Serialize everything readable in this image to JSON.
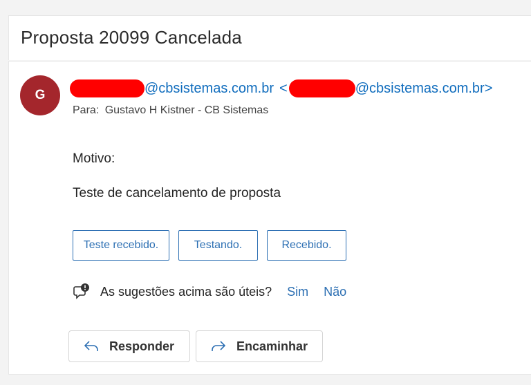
{
  "subject": "Proposta 20099 Cancelada",
  "sender": {
    "avatar_initial": "G",
    "avatar_color": "#a4262c",
    "domain_part": "@cbsistemas.com.br",
    "open_bracket": "<",
    "domain_part_2": "@cbsistemas.com.br>"
  },
  "recipients": {
    "label": "Para:",
    "value": "Gustavo H Kistner - CB Sistemas"
  },
  "body": {
    "line1": "Motivo:",
    "line2": "Teste de cancelamento de proposta"
  },
  "quick_replies": [
    "Teste recebido.",
    "Testando.",
    "Recebido."
  ],
  "feedback": {
    "question": "As sugestões acima são úteis?",
    "yes": "Sim",
    "no": "Não"
  },
  "actions": {
    "reply": "Responder",
    "forward": "Encaminhar"
  },
  "colors": {
    "link": "#2c6fb3",
    "redaction": "#ff0000"
  }
}
